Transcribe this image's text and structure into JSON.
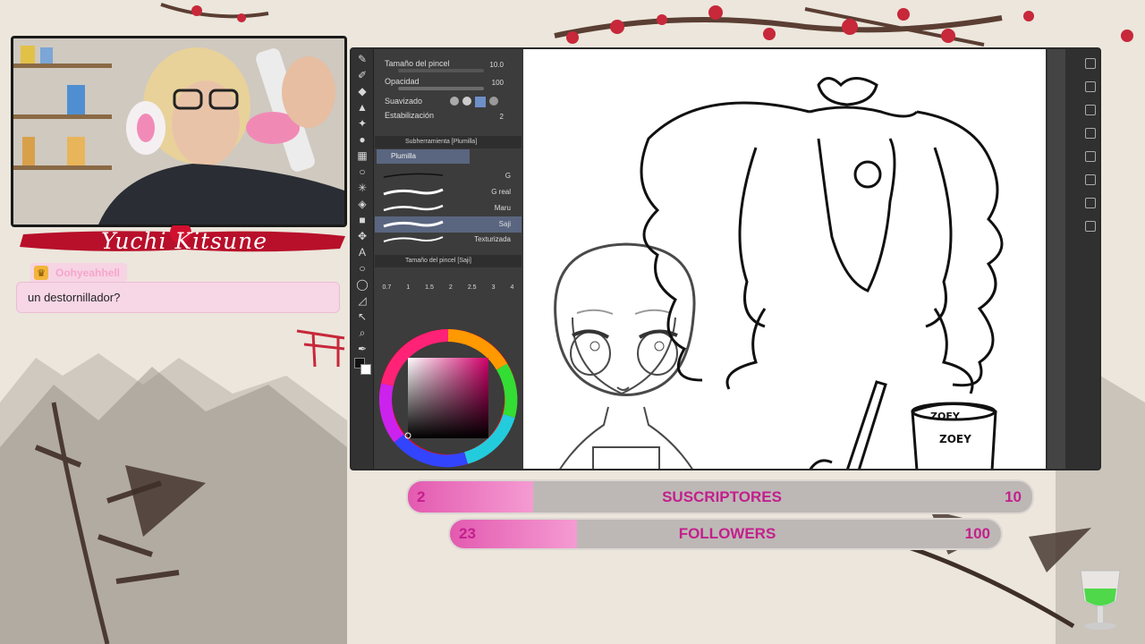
{
  "streamer": {
    "name": "Yuchi  Kitsune"
  },
  "chat": {
    "username": "Oohyeahhell",
    "message": "un destornillador?"
  },
  "app": {
    "properties": [
      {
        "label": "Tamaño del pincel",
        "value": "10.0"
      },
      {
        "label": "Opacidad",
        "value": "100"
      },
      {
        "label": "Suavizado",
        "value": ""
      },
      {
        "label": "Estabilización",
        "value": "2"
      }
    ],
    "subtool_header": "Subherramienta [Plumilla]",
    "subtool_selected": "Plumilla",
    "brushes": [
      {
        "name": "G"
      },
      {
        "name": "G real"
      },
      {
        "name": "Maru"
      },
      {
        "name": "Saji"
      },
      {
        "name": "Texturizada"
      }
    ],
    "size_header": "Tamaño del pincel [Saji]",
    "size_presets": [
      "0.7",
      "1",
      "1.5",
      "2",
      "2.5",
      "3",
      "4"
    ],
    "canvas_labels": {
      "bowl_text_1": "ZOEY",
      "bowl_text_2": "ZOEY"
    }
  },
  "goals": [
    {
      "label": "SUSCRIPTORES",
      "current": "2",
      "target": "10",
      "progress": 0.2
    },
    {
      "label": "FOLLOWERS",
      "current": "23",
      "target": "100",
      "progress": 0.23
    }
  ],
  "colors": {
    "accent_pink": "#e35ab0",
    "nameplate_red": "#c8102e",
    "app_dark": "#3a3a3a"
  }
}
